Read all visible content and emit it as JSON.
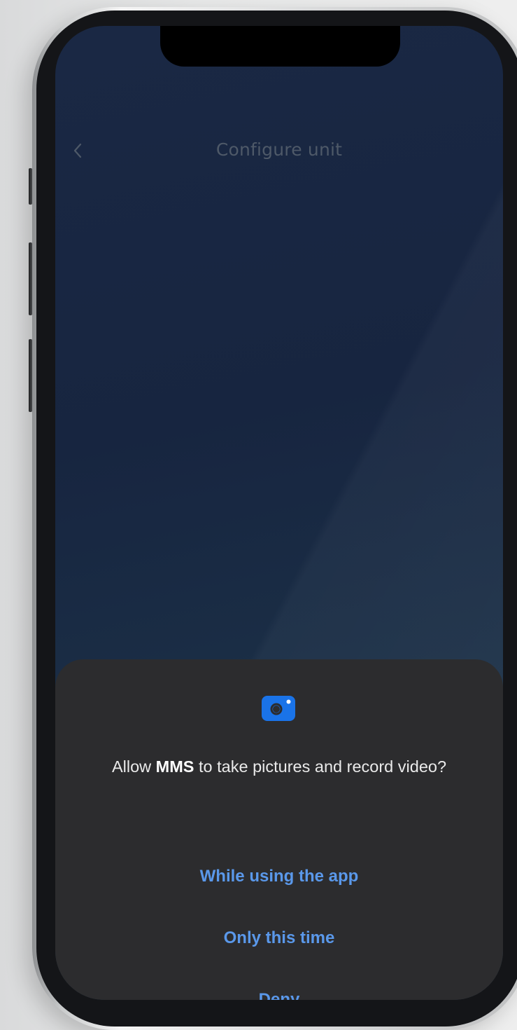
{
  "header": {
    "title": "Configure unit",
    "back_icon": "chevron-left-icon"
  },
  "permission_dialog": {
    "icon": "camera-icon",
    "prompt_prefix": "Allow ",
    "app_name": "MMS",
    "prompt_suffix": " to take pictures and record video?",
    "options": {
      "while_using": "While using the app",
      "only_this_time": "Only this time",
      "deny": "Deny"
    }
  },
  "colors": {
    "accent": "#5a98ea",
    "icon": "#1a73e8",
    "sheet_background": "#2c2c2e",
    "screen_background": "#172540"
  }
}
